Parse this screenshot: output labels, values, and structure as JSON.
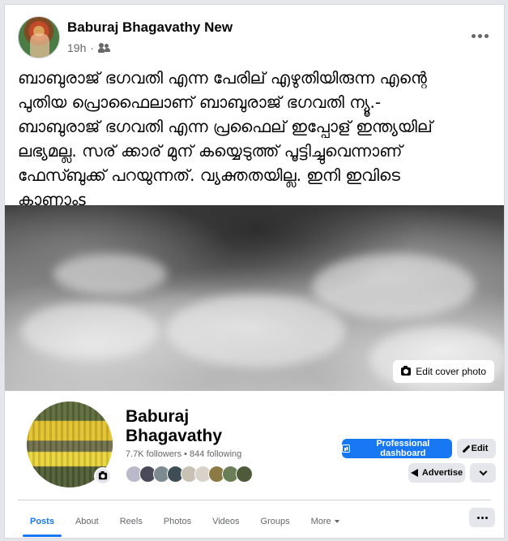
{
  "post": {
    "author": "Baburaj Bhagavathy New",
    "time": "19h",
    "audience_icon": "friends-icon",
    "more_icon": "more-horizontal-icon",
    "text": "ബാബുരാജ് ഭഗവതി എന്ന പേരില് എഴുതിയിരുന്ന എന്റെ\nപുതിയ പ്രൊഫൈലാണ് ബാബുരാജ് ഭഗവതി ന്യൂ.-\nബാബുരാജ് ഭഗവതി എന്ന പ്രഫൈല് ഇപ്പോള് ഇന്ത്യയില്\nലഭ്യമല്ല. സര് ക്കാര് മുന് കയ്യെടുത്ത് പൂട്ടിച്ചുവെന്നാണ്\nഫേസ്ബുക്ക് പറയുന്നത്. വ്യക്തതയില്ല.   ഇനി ഇവിടെ\nകാണാംs"
  },
  "profile": {
    "cover_button": "Edit cover photo",
    "name": "Baburaj Bhagavathy",
    "follow_line": "7.7K followers • 844 following",
    "buttons": {
      "dashboard": "Professional dashboard",
      "edit": "Edit",
      "advertise": "Advertise"
    },
    "tabs": [
      {
        "label": "Posts",
        "active": true
      },
      {
        "label": "About"
      },
      {
        "label": "Reels"
      },
      {
        "label": "Photos"
      },
      {
        "label": "Videos"
      },
      {
        "label": "Groups"
      },
      {
        "label": "More"
      }
    ]
  },
  "colors": {
    "accent": "#1877f2",
    "secondary_text": "#65676b",
    "button_gray": "#e4e6eb"
  }
}
